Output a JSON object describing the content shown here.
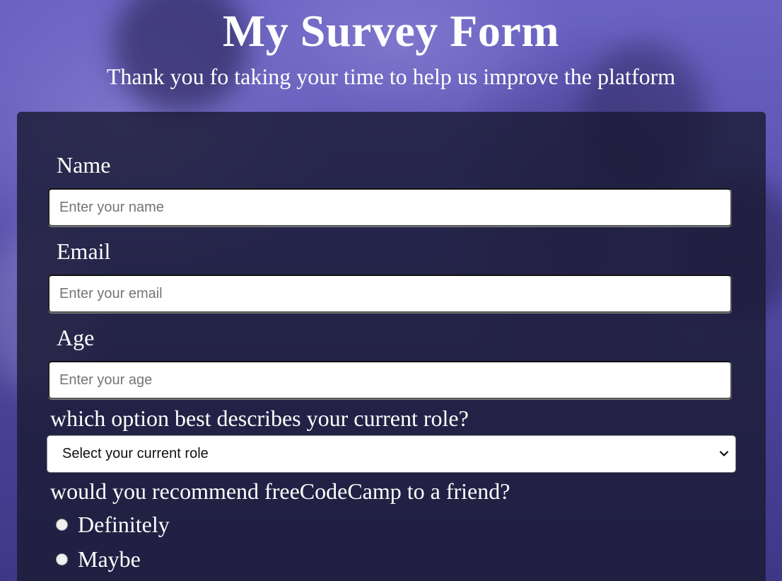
{
  "header": {
    "title": "My Survey Form",
    "subtitle": "Thank you fo taking your time to help us improve the platform"
  },
  "form": {
    "name": {
      "label": "Name",
      "placeholder": "Enter your name"
    },
    "email": {
      "label": "Email",
      "placeholder": "Enter your email"
    },
    "age": {
      "label": "Age",
      "placeholder": "Enter your age"
    },
    "role": {
      "question": "which option best describes your current role?",
      "selected": "Select your current role",
      "chevron_icon": "chevron-down-icon"
    },
    "recommend": {
      "question": "would you recommend freeCodeCamp to a friend?",
      "options": [
        "Definitely",
        "Maybe"
      ]
    }
  },
  "colors": {
    "background": "#5d56b4",
    "card": "#1b1b34",
    "text": "#ffffff"
  }
}
